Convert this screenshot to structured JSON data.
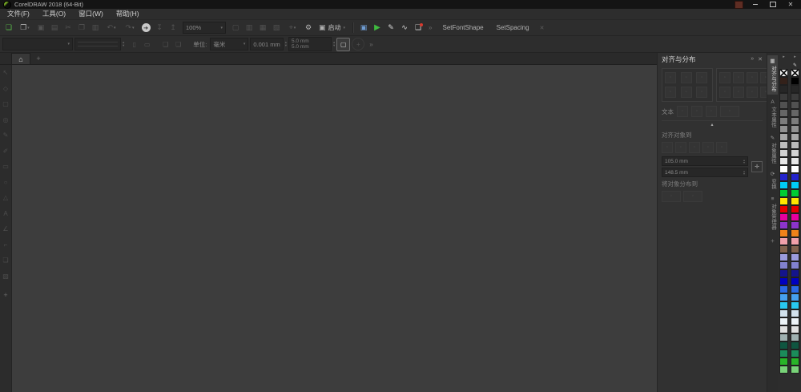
{
  "titlebar": {
    "title": "CorelDRAW 2018 (64-Bit)"
  },
  "menubar": {
    "items": [
      {
        "label": "文件(F)",
        "name": "menu-file"
      },
      {
        "label": "工具(O)",
        "name": "menu-tools"
      },
      {
        "label": "窗口(W)",
        "name": "menu-window"
      },
      {
        "label": "帮助(H)",
        "name": "menu-help"
      }
    ]
  },
  "toolbar": {
    "zoom_level": "100%",
    "launch_label": "启动",
    "overflow_glyph": "»",
    "close_glyph": "✕",
    "icons_main": [
      {
        "name": "new-document-icon",
        "glyph": "❏",
        "cls": "c-new"
      },
      {
        "name": "open-icon",
        "glyph": "❐",
        "caret": true
      },
      {
        "name": "save-icon",
        "glyph": "▣",
        "cls": "dis"
      },
      {
        "name": "print-icon",
        "glyph": "▤",
        "cls": "dis"
      },
      {
        "name": "cut-icon",
        "glyph": "✂",
        "cls": "dis"
      },
      {
        "name": "copy-icon",
        "glyph": "❐",
        "cls": "dis"
      },
      {
        "name": "paste-icon",
        "glyph": "▥",
        "cls": "dis"
      },
      {
        "name": "undo-icon",
        "glyph": "↶",
        "cls": "dis",
        "caret": true
      },
      {
        "name": "redo-icon",
        "glyph": "↷",
        "cls": "dis",
        "caret": true
      },
      {
        "name": "search-content-icon",
        "glyph": "➔",
        "cls": "c-circle"
      },
      {
        "name": "import-icon",
        "glyph": "↧",
        "cls": "dis"
      },
      {
        "name": "export-icon",
        "glyph": "↥",
        "cls": "dis"
      }
    ],
    "icons_view": [
      {
        "name": "fullscreen-preview-icon",
        "glyph": "▢",
        "cls": "dis"
      },
      {
        "name": "show-rulers-icon",
        "glyph": "▥",
        "cls": "dis"
      },
      {
        "name": "show-grid-icon",
        "glyph": "▦",
        "cls": "dis"
      },
      {
        "name": "show-guidelines-icon",
        "glyph": "▧",
        "cls": "dis"
      },
      {
        "name": "snap-to-icon",
        "glyph": "⌖",
        "cls": "dis",
        "caret": true
      }
    ],
    "icons_app": [
      {
        "name": "welcome-screen-icon",
        "glyph": "▣",
        "cls": "c-blue"
      },
      {
        "name": "play-tutorial-icon",
        "glyph": "▶",
        "cls": "c-green2"
      },
      {
        "name": "edit-drawing-icon",
        "glyph": "✎",
        "cls": "c-white"
      },
      {
        "name": "signature-chart-icon",
        "glyph": "∿",
        "cls": "c-white"
      },
      {
        "name": "clipboard-tasks-icon",
        "glyph": "❑",
        "cls": "c-white",
        "badge": true
      }
    ],
    "macros": [
      {
        "label": "SetFontShape",
        "name": "macro-setfontshape-button"
      },
      {
        "label": "SetSpacing",
        "name": "macro-setspacing-button"
      }
    ]
  },
  "property_bar": {
    "units_label": "单位:",
    "units_value": "毫米",
    "nudge_value": "0.001 mm",
    "duplicate_x": "5.0 mm",
    "duplicate_y": "5.0 mm",
    "orientation_buttons": [
      {
        "name": "portrait-button",
        "glyph": "▯"
      },
      {
        "name": "landscape-button",
        "glyph": "▭"
      }
    ],
    "page_mode_buttons": [
      {
        "name": "all-pages-button",
        "glyph": "❑"
      },
      {
        "name": "current-page-button",
        "glyph": "❏"
      }
    ]
  },
  "toolbox": {
    "tools": [
      {
        "name": "pick-tool",
        "glyph": "↖"
      },
      {
        "name": "shape-tool",
        "glyph": "◇"
      },
      {
        "name": "crop-tool",
        "glyph": "▢"
      },
      {
        "name": "zoom-tool",
        "glyph": "◎"
      },
      {
        "name": "freehand-tool",
        "glyph": "✎"
      },
      {
        "name": "artistic-media-tool",
        "glyph": "✐"
      },
      {
        "name": "rectangle-tool",
        "glyph": "▭"
      },
      {
        "name": "ellipse-tool",
        "glyph": "○"
      },
      {
        "name": "polygon-tool",
        "glyph": "△"
      },
      {
        "name": "text-tool",
        "glyph": "A"
      },
      {
        "name": "dimension-tool",
        "glyph": "∠"
      },
      {
        "name": "connector-tool",
        "glyph": "⌐"
      },
      {
        "name": "drop-shadow-tool",
        "glyph": "❏"
      },
      {
        "name": "transparency-tool",
        "glyph": "▨"
      }
    ]
  },
  "docker": {
    "title": "对齐与分布",
    "text_label": "文本",
    "align_to_label": "对齐对象到",
    "distribute_to_label": "将对象分布到",
    "x_value": "105.0 mm",
    "y_value": "148.5 mm",
    "align_buttons": [
      {
        "name": "align-left-button"
      },
      {
        "name": "align-center-horizontal-button"
      },
      {
        "name": "align-right-button"
      },
      {
        "name": "align-top-button"
      },
      {
        "name": "align-center-vertical-button"
      },
      {
        "name": "align-bottom-button"
      }
    ],
    "distribute_buttons": [
      {
        "name": "distribute-left-button"
      },
      {
        "name": "distribute-center-horizontal-button"
      },
      {
        "name": "distribute-spacing-horizontal-button"
      },
      {
        "name": "distribute-right-button"
      },
      {
        "name": "distribute-top-button"
      },
      {
        "name": "distribute-center-vertical-button"
      },
      {
        "name": "distribute-spacing-vertical-button"
      },
      {
        "name": "distribute-bottom-button"
      }
    ],
    "text_buttons": [
      {
        "name": "text-first-line-button"
      },
      {
        "name": "text-baseline-button"
      },
      {
        "name": "text-bounding-box-button"
      },
      {
        "name": "text-mode-combo-button",
        "cls": "wide"
      }
    ],
    "align_to_buttons": [
      {
        "name": "align-to-active-object-button"
      },
      {
        "name": "align-to-page-edge-button"
      },
      {
        "name": "align-to-page-center-button"
      },
      {
        "name": "align-to-grid-button"
      },
      {
        "name": "align-to-point-button"
      }
    ],
    "distribute_to_buttons": [
      {
        "name": "distribute-to-selection-button",
        "cls": "wide"
      },
      {
        "name": "distribute-to-page-button",
        "cls": "wide"
      }
    ]
  },
  "docker_tabs": {
    "items": [
      {
        "label": "对齐与分布",
        "glyph": "▦",
        "name": "docker-tab-align-distribute",
        "active": true
      },
      {
        "label": "文本属性",
        "glyph": "A",
        "name": "docker-tab-text-properties"
      },
      {
        "label": "对象属性",
        "glyph": "✎",
        "name": "docker-tab-object-properties"
      },
      {
        "label": "变换",
        "glyph": "⟳",
        "name": "docker-tab-transform"
      },
      {
        "label": "对象管理器",
        "glyph": "≡",
        "name": "docker-tab-object-manager"
      }
    ]
  },
  "palettes": {
    "left": [
      {
        "t": "arrow"
      },
      {
        "t": "blank"
      },
      {
        "t": "nofill"
      },
      {
        "t": "color",
        "hex": "#33211a"
      },
      {
        "t": "color",
        "hex": "#262626"
      },
      {
        "t": "color",
        "hex": "#3b3b3b"
      },
      {
        "t": "color",
        "hex": "#515151"
      },
      {
        "t": "color",
        "hex": "#666666"
      },
      {
        "t": "color",
        "hex": "#7c7c7c"
      },
      {
        "t": "color",
        "hex": "#919191"
      },
      {
        "t": "color",
        "hex": "#a7a7a7"
      },
      {
        "t": "color",
        "hex": "#bcbcbc"
      },
      {
        "t": "color",
        "hex": "#d2d2d2"
      },
      {
        "t": "color",
        "hex": "#e7e7e7"
      },
      {
        "t": "color",
        "hex": "#ffffff"
      },
      {
        "t": "color",
        "hex": "#2424cc"
      },
      {
        "t": "color",
        "hex": "#00ccf5"
      },
      {
        "t": "color",
        "hex": "#00cc33"
      },
      {
        "t": "color",
        "hex": "#ffe600"
      },
      {
        "t": "color",
        "hex": "#e60000"
      },
      {
        "t": "color",
        "hex": "#e600a0"
      },
      {
        "t": "color",
        "hex": "#8c34cc"
      },
      {
        "t": "color",
        "hex": "#f08219"
      },
      {
        "t": "color",
        "hex": "#f0a0aa"
      },
      {
        "t": "color",
        "hex": "#80614d"
      },
      {
        "t": "color",
        "hex": "#9b9bdd"
      },
      {
        "t": "color",
        "hex": "#8181cf"
      },
      {
        "t": "color",
        "hex": "#14148c"
      },
      {
        "t": "color",
        "hex": "#0000c0"
      },
      {
        "t": "color",
        "hex": "#2a6ae6"
      },
      {
        "t": "color",
        "hex": "#46a0f0"
      },
      {
        "t": "color",
        "hex": "#28c8f0"
      },
      {
        "t": "color",
        "hex": "#d2e1ec"
      },
      {
        "t": "color",
        "hex": "#edf3f7"
      },
      {
        "t": "color",
        "hex": "#e0e0e0"
      },
      {
        "t": "color",
        "hex": "#9fb0b0"
      },
      {
        "t": "color",
        "hex": "#0f5540"
      },
      {
        "t": "color",
        "hex": "#1b8c5a"
      },
      {
        "t": "color",
        "hex": "#28b428"
      },
      {
        "t": "color",
        "hex": "#78d278"
      }
    ],
    "right": [
      {
        "t": "arrow"
      },
      {
        "t": "eyedropper"
      },
      {
        "t": "nofill"
      },
      {
        "t": "color",
        "hex": "#000000"
      },
      {
        "t": "color",
        "hex": "#262626"
      },
      {
        "t": "color",
        "hex": "#3b3b3b"
      },
      {
        "t": "color",
        "hex": "#515151"
      },
      {
        "t": "color",
        "hex": "#666666"
      },
      {
        "t": "color",
        "hex": "#7c7c7c"
      },
      {
        "t": "color",
        "hex": "#919191"
      },
      {
        "t": "color",
        "hex": "#a7a7a7"
      },
      {
        "t": "color",
        "hex": "#bcbcbc"
      },
      {
        "t": "color",
        "hex": "#d2d2d2"
      },
      {
        "t": "color",
        "hex": "#e7e7e7"
      },
      {
        "t": "color",
        "hex": "#ffffff"
      },
      {
        "t": "color",
        "hex": "#2424cc"
      },
      {
        "t": "color",
        "hex": "#00ccf5"
      },
      {
        "t": "color",
        "hex": "#00cc33"
      },
      {
        "t": "color",
        "hex": "#ffe600"
      },
      {
        "t": "color",
        "hex": "#e60000"
      },
      {
        "t": "color",
        "hex": "#e600a0"
      },
      {
        "t": "color",
        "hex": "#8c34cc"
      },
      {
        "t": "color",
        "hex": "#f08219"
      },
      {
        "t": "color",
        "hex": "#f0a0aa"
      },
      {
        "t": "color",
        "hex": "#80614d"
      },
      {
        "t": "color",
        "hex": "#9b9bdd"
      },
      {
        "t": "color",
        "hex": "#8181cf"
      },
      {
        "t": "color",
        "hex": "#14148c"
      },
      {
        "t": "color",
        "hex": "#0000c0"
      },
      {
        "t": "color",
        "hex": "#2a6ae6"
      },
      {
        "t": "color",
        "hex": "#46a0f0"
      },
      {
        "t": "color",
        "hex": "#28c8f0"
      },
      {
        "t": "color",
        "hex": "#d2e1ec"
      },
      {
        "t": "color",
        "hex": "#edf3f7"
      },
      {
        "t": "color",
        "hex": "#e0e0e0"
      },
      {
        "t": "color",
        "hex": "#9fb0b0"
      },
      {
        "t": "color",
        "hex": "#0f5540"
      },
      {
        "t": "color",
        "hex": "#1b8c5a"
      },
      {
        "t": "color",
        "hex": "#28b428"
      },
      {
        "t": "color",
        "hex": "#78d278"
      }
    ]
  }
}
